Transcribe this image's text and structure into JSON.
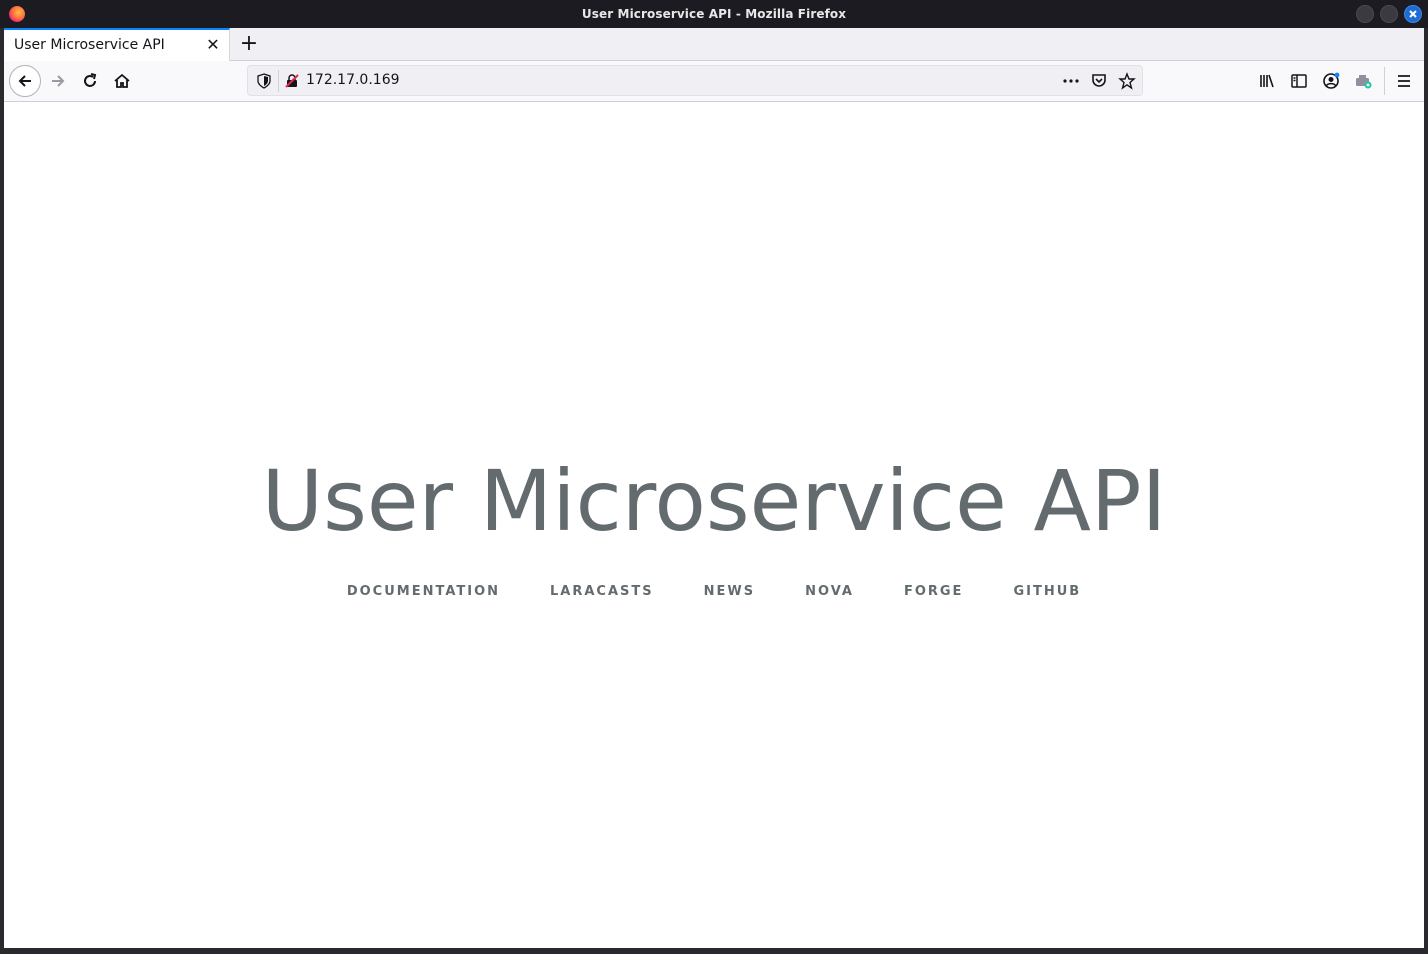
{
  "window": {
    "title": "User Microservice API - Mozilla Firefox"
  },
  "tabs": [
    {
      "label": "User Microservice API",
      "active": true
    }
  ],
  "toolbar": {
    "url": "172.17.0.169",
    "new_tab_symbol": "+",
    "tab_close_symbol": "✕"
  },
  "icons": {
    "back": "back-arrow-icon",
    "forward": "forward-arrow-icon",
    "reload": "reload-icon",
    "home": "home-icon",
    "tracking": "shield-icon",
    "insecure": "insecure-lock-icon",
    "page_actions": "more-actions-icon",
    "pocket": "pocket-icon",
    "bookmark": "star-icon",
    "library": "library-icon",
    "sidebar": "sidebar-icon",
    "account": "account-icon",
    "extension": "extension-icon",
    "menu": "hamburger-menu-icon"
  },
  "page": {
    "title": "User Microservice API",
    "links": [
      "Documentation",
      "Laracasts",
      "News",
      "Nova",
      "Forge",
      "GitHub"
    ]
  },
  "colors": {
    "text": "#636b6f",
    "tab_accent": "#0a84ff"
  }
}
